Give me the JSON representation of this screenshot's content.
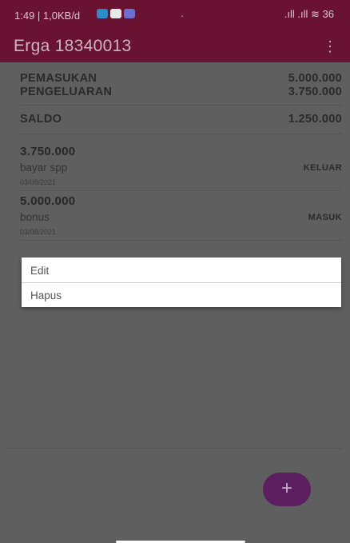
{
  "status": {
    "time": "1:49 | 1,0KB/d",
    "dot": "·",
    "signal": ".ıll .ıll ≋ 36"
  },
  "toolbar": {
    "title": "Erga 18340013",
    "menu_icon": "⋮"
  },
  "summary": {
    "income_label": "PEMASUKAN",
    "income_value": "5.000.000",
    "expense_label": "PENGELUARAN",
    "expense_value": "3.750.000",
    "balance_label": "SALDO",
    "balance_value": "1.250.000"
  },
  "transactions": [
    {
      "amount": "3.750.000",
      "desc": "bayar spp",
      "date": "03/08/2021",
      "type": "KELUAR"
    },
    {
      "amount": "5.000.000",
      "desc": "bonus",
      "date": "03/08/2021",
      "type": "MASUK"
    }
  ],
  "popup": {
    "items": [
      {
        "label": "Edit"
      },
      {
        "label": "Hapus"
      }
    ]
  },
  "fab": {
    "icon": "+"
  },
  "colors": {
    "appbar": "#6a1232",
    "fab": "#5b1f5f",
    "scrim": "#5f5f5f"
  }
}
